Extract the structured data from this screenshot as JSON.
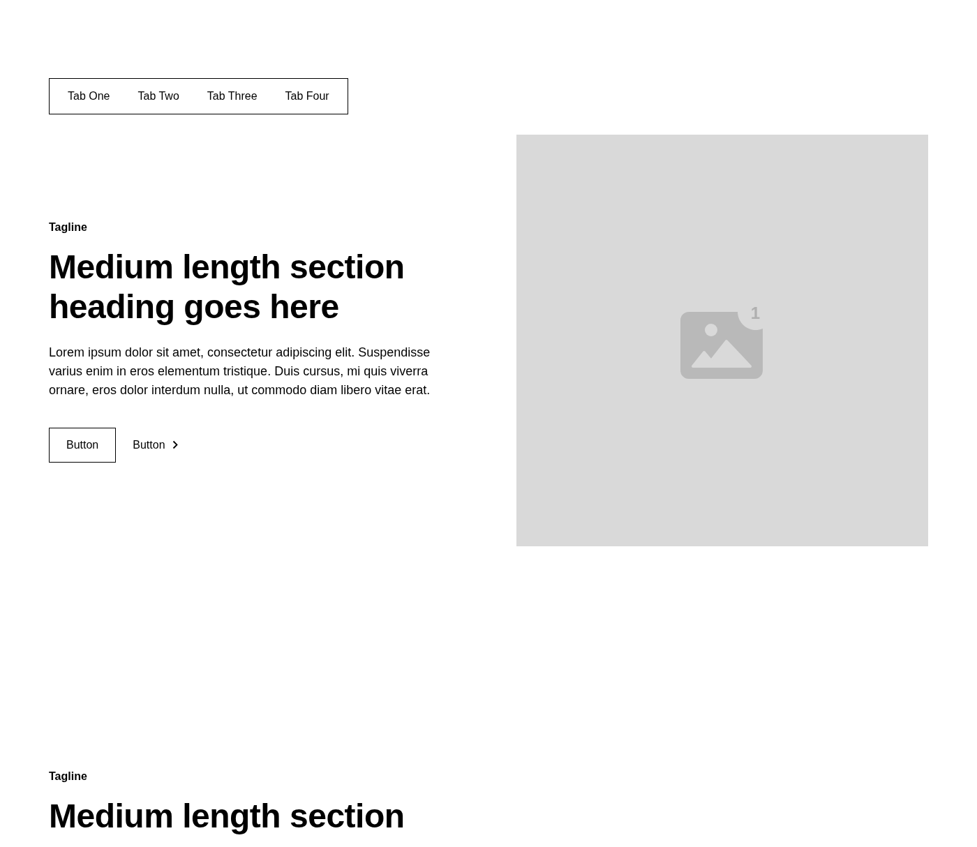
{
  "tabs": [
    {
      "label": "Tab One"
    },
    {
      "label": "Tab Two"
    },
    {
      "label": "Tab Three"
    },
    {
      "label": "Tab Four"
    }
  ],
  "section": {
    "tagline": "Tagline",
    "heading": "Medium length section heading goes here",
    "body": "Lorem ipsum dolor sit amet, consectetur adipiscing elit. Suspendisse varius enim in eros elementum tristique. Duis cursus, mi quis viverra ornare, eros dolor interdum nulla, ut commodo diam libero vitae erat.",
    "buttons": [
      {
        "label": "Button",
        "kind": "outline"
      },
      {
        "label": "Button",
        "kind": "link"
      }
    ],
    "image": {
      "badge": "1"
    }
  },
  "next_section": {
    "tagline": "Tagline",
    "heading": "Medium length section"
  }
}
